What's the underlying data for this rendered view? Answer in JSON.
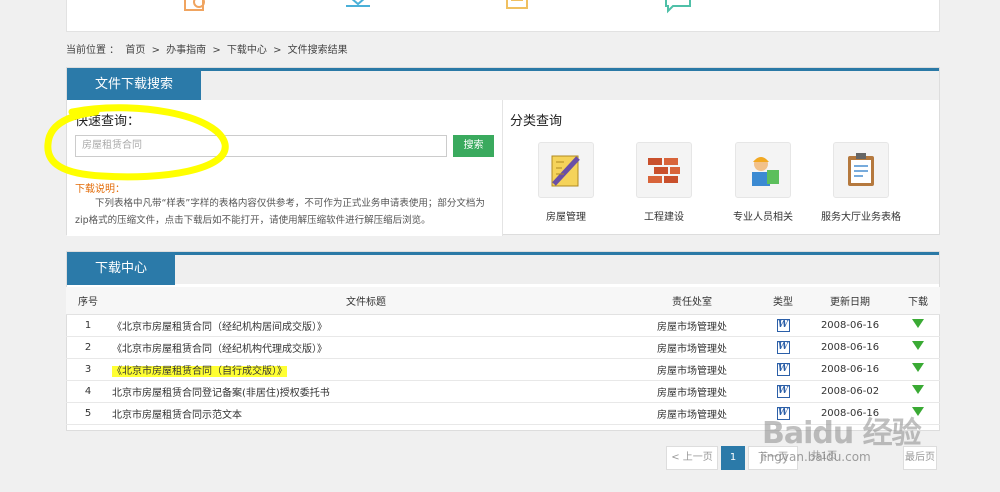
{
  "breadcrumb": {
    "label": "当前位置 ：",
    "items": [
      "首页",
      ">",
      "办事指南",
      ">",
      "下载中心",
      ">",
      "文件搜索结果"
    ]
  },
  "search_panel": {
    "tab": "文件下载搜索",
    "quick_label": "快速查询：",
    "input_value": "房屋租赁合同",
    "button": "搜索",
    "note_title": "下载说明：",
    "note_text": "下列表格中凡带“样表”字样的表格内容仅供参考，不可作为正式业务申请表使用；部分文档为zip格式的压缩文件，点击下载后如不能打开，请使用解压缩软件进行解压缩后浏览。",
    "category_title": "分类查询",
    "categories": [
      {
        "label": "房屋管理",
        "icon": "pencil-ruler-icon"
      },
      {
        "label": "工程建设",
        "icon": "brick-wall-icon"
      },
      {
        "label": "专业人员相关",
        "icon": "worker-icon"
      },
      {
        "label": "服务大厅业务表格",
        "icon": "clipboard-icon"
      }
    ]
  },
  "download_panel": {
    "tab": "下载中心",
    "columns": [
      "序号",
      "文件标题",
      "责任处室",
      "类型",
      "更新日期",
      "下载"
    ],
    "rows": [
      {
        "no": "1",
        "title": "《北京市房屋租赁合同（经纪机构居间成交版）》",
        "dept": "房屋市场管理处",
        "date": "2008-06-16"
      },
      {
        "no": "2",
        "title": "《北京市房屋租赁合同（经纪机构代理成交版）》",
        "dept": "房屋市场管理处",
        "date": "2008-06-16"
      },
      {
        "no": "3",
        "title": "《北京市房屋租赁合同（自行成交版）》",
        "dept": "房屋市场管理处",
        "date": "2008-06-16"
      },
      {
        "no": "4",
        "title": "北京市房屋租赁合同登记备案(非居住)授权委托书",
        "dept": "房屋市场管理处",
        "date": "2008-06-02"
      },
      {
        "no": "5",
        "title": "北京市房屋租赁合同示范文本",
        "dept": "房屋市场管理处",
        "date": "2008-06-16"
      }
    ],
    "pager": {
      "prev": "< 上一页",
      "current": "1",
      "next": "下一页",
      "page_of": "共1页",
      "last": "最后页"
    }
  },
  "watermark": {
    "brand": "Baidu 经验",
    "url": "jingyan.baidu.com"
  },
  "colors": {
    "accent": "#2b7aa9",
    "button": "#3aaa5e",
    "highlight": "#ffff33",
    "note": "#e36c09"
  }
}
